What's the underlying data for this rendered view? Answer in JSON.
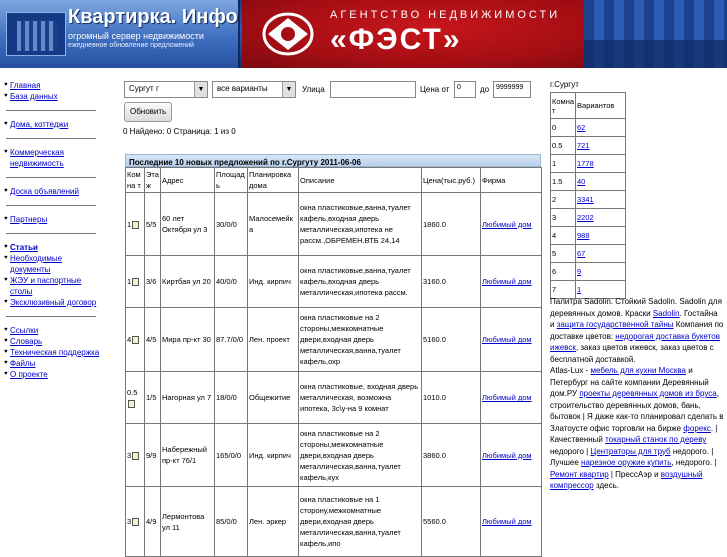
{
  "banner": {
    "site_title": "Квартирка. Инфо",
    "site_sub1": "огромный сервер недвижимости",
    "site_sub2": "ежедневное обновление предложений",
    "agency_top": "АГЕНТСТВО НЕДВИЖИМОСТИ",
    "agency_name": "«ФЭСТ»"
  },
  "sidebar": {
    "items": [
      {
        "label": "Главная"
      },
      {
        "label": "База данных"
      },
      {
        "label": "Дома, коттеджи"
      },
      {
        "label": "Коммерческая недвижимость"
      },
      {
        "label": "Доска объявлений"
      },
      {
        "label": "Партнеры"
      },
      {
        "label": "Статьи"
      },
      {
        "label": "Необходимые документы"
      },
      {
        "label": "ЖЭУ и паспортные столы"
      },
      {
        "label": "Эксклюзивный договор"
      },
      {
        "label": "Ссылки"
      },
      {
        "label": "Словарь"
      },
      {
        "label": "Техническая поддержка"
      },
      {
        "label": "Файлы"
      },
      {
        "label": "О проекте"
      }
    ]
  },
  "filters": {
    "city": "Сургут г",
    "variant": "все варианты",
    "street_label": "Улица",
    "street_value": "",
    "price_label": "Цена от",
    "price_from": "0",
    "price_to_label": "до",
    "price_to": "9999999",
    "refresh": "Обновить"
  },
  "found_text": "0 Найдено: 0   Страница: 1 из 0",
  "listing": {
    "caption": "Последние 10 новых предложений по г.Сургуту 2011-06-06",
    "headers": [
      "Комна т",
      "Эта ж",
      "Адрес",
      "Площад ь",
      "Планировка дома",
      "Описание",
      "Цена(тыс.руб.)",
      "Фирма"
    ],
    "rows": [
      {
        "rooms": "1",
        "floor": "5/5",
        "address": "60 лет Октября ул 3",
        "area": "30/0/0",
        "plan": "Малосемейк а",
        "desc": "окна пластиковые,ванна,туалет кафель,входная дверь металлическая,ипотека не рассм.,ОБРЕМЕН.ВТБ 24,14",
        "price": "1860.0",
        "firm": "Любимый дом"
      },
      {
        "rooms": "1",
        "floor": "3/6",
        "address": "Киртбая ул 20",
        "area": "40/0/0",
        "plan": "Инд. кирпич",
        "desc": "окна пластиковые,ванна,туалет кафель,входная дверь металлическая,ипотека рассм.",
        "price": "3160.0",
        "firm": "Любимый дом"
      },
      {
        "rooms": "4",
        "floor": "4/5",
        "address": "Мира пр-кт 30",
        "area": "87.7/0/0",
        "plan": "Лен. проект",
        "desc": "окна пластиковые на 2 стороны,межкомнатные двери,входная дверь металлическая,ванна,туалет кафель,охр",
        "price": "5160.0",
        "firm": "Любимый дом"
      },
      {
        "rooms": "0.5",
        "floor": "1/5",
        "address": "Нагорная ул 7",
        "area": "18/0/0",
        "plan": "Общежитие",
        "desc": "окна пластиковые, входная дверь металлическая, возможна ипотека, 3с\\у-на 9 комнат",
        "price": "1010.0",
        "firm": "Любимый дом"
      },
      {
        "rooms": "3",
        "floor": "9/9",
        "address": "Набережный пр-кт 76/1",
        "area": "165/0/0",
        "plan": "Инд. кирпич",
        "desc": "окна пластиковые на 2 стороны,межкомнатные двери,входная дверь металлическая,ванна,туалет кафель,кух",
        "price": "3860.0",
        "firm": "Любимый дом"
      },
      {
        "rooms": "3",
        "floor": "4/9",
        "address": "Лермонтова ул 11",
        "area": "85/0/0",
        "plan": "Лен. эркер",
        "desc": "окна пластиковые на 1 сторону,межкомнатные двери,входная дверь металлическая,ванна,туалет кафель,ипо",
        "price": "5560.0",
        "firm": "Любимый дом"
      }
    ]
  },
  "right_panel": {
    "city": "г.Сургут",
    "headers": [
      "Комна т",
      "Вариантов"
    ],
    "rows": [
      {
        "rooms": "0",
        "count": "62"
      },
      {
        "rooms": "0.5",
        "count": "721"
      },
      {
        "rooms": "1",
        "count": "1778"
      },
      {
        "rooms": "1.5",
        "count": "40"
      },
      {
        "rooms": "2",
        "count": "3341"
      },
      {
        "rooms": "3",
        "count": "2202"
      },
      {
        "rooms": "4",
        "count": "988"
      },
      {
        "rooms": "5",
        "count": "67"
      },
      {
        "rooms": "6",
        "count": "9"
      },
      {
        "rooms": "7",
        "count": "1"
      }
    ]
  },
  "ads": {
    "t1": "Палитра Sadolin. Стойкий Sadolin. Sadolin для деревянных домов. Краски ",
    "l1": "Sadolin",
    "t2": ". Гостайна и ",
    "l2": "защита государственной тайны",
    "t3": " Компания по доставке цветов: ",
    "l3": "недорогая доставка букетов ижевск",
    "t4": ", заказ цветов ижевск, заказ цветов с бесплатной доставкой.",
    "t5": "Atlas-Lux - ",
    "l5": "мебель для кухни Москва",
    "t6": " и Петербург на сайте компании Деревянный дом.РУ ",
    "l6": "проекты деревянных домов из бруса",
    "t7": ", строительство деревянных домов, бань, бытовок | Я даже как-то планировал сделать в Златоусте офис торговли на бирже ",
    "l7": "форекс",
    "t8": ". | Качественный ",
    "l8": "токарный станок по дереву",
    "t9": " недорого | ",
    "l9": "Центраторы для труб",
    "t10": " недорого. | Лучшее ",
    "l10": "нарезное оружие купить",
    "t11": ", недорого. | ",
    "l11": "Ремонт квартир",
    "t12": " | ПрессАэр и ",
    "l12": "воздушный компрессор",
    "t13": " здесь."
  }
}
